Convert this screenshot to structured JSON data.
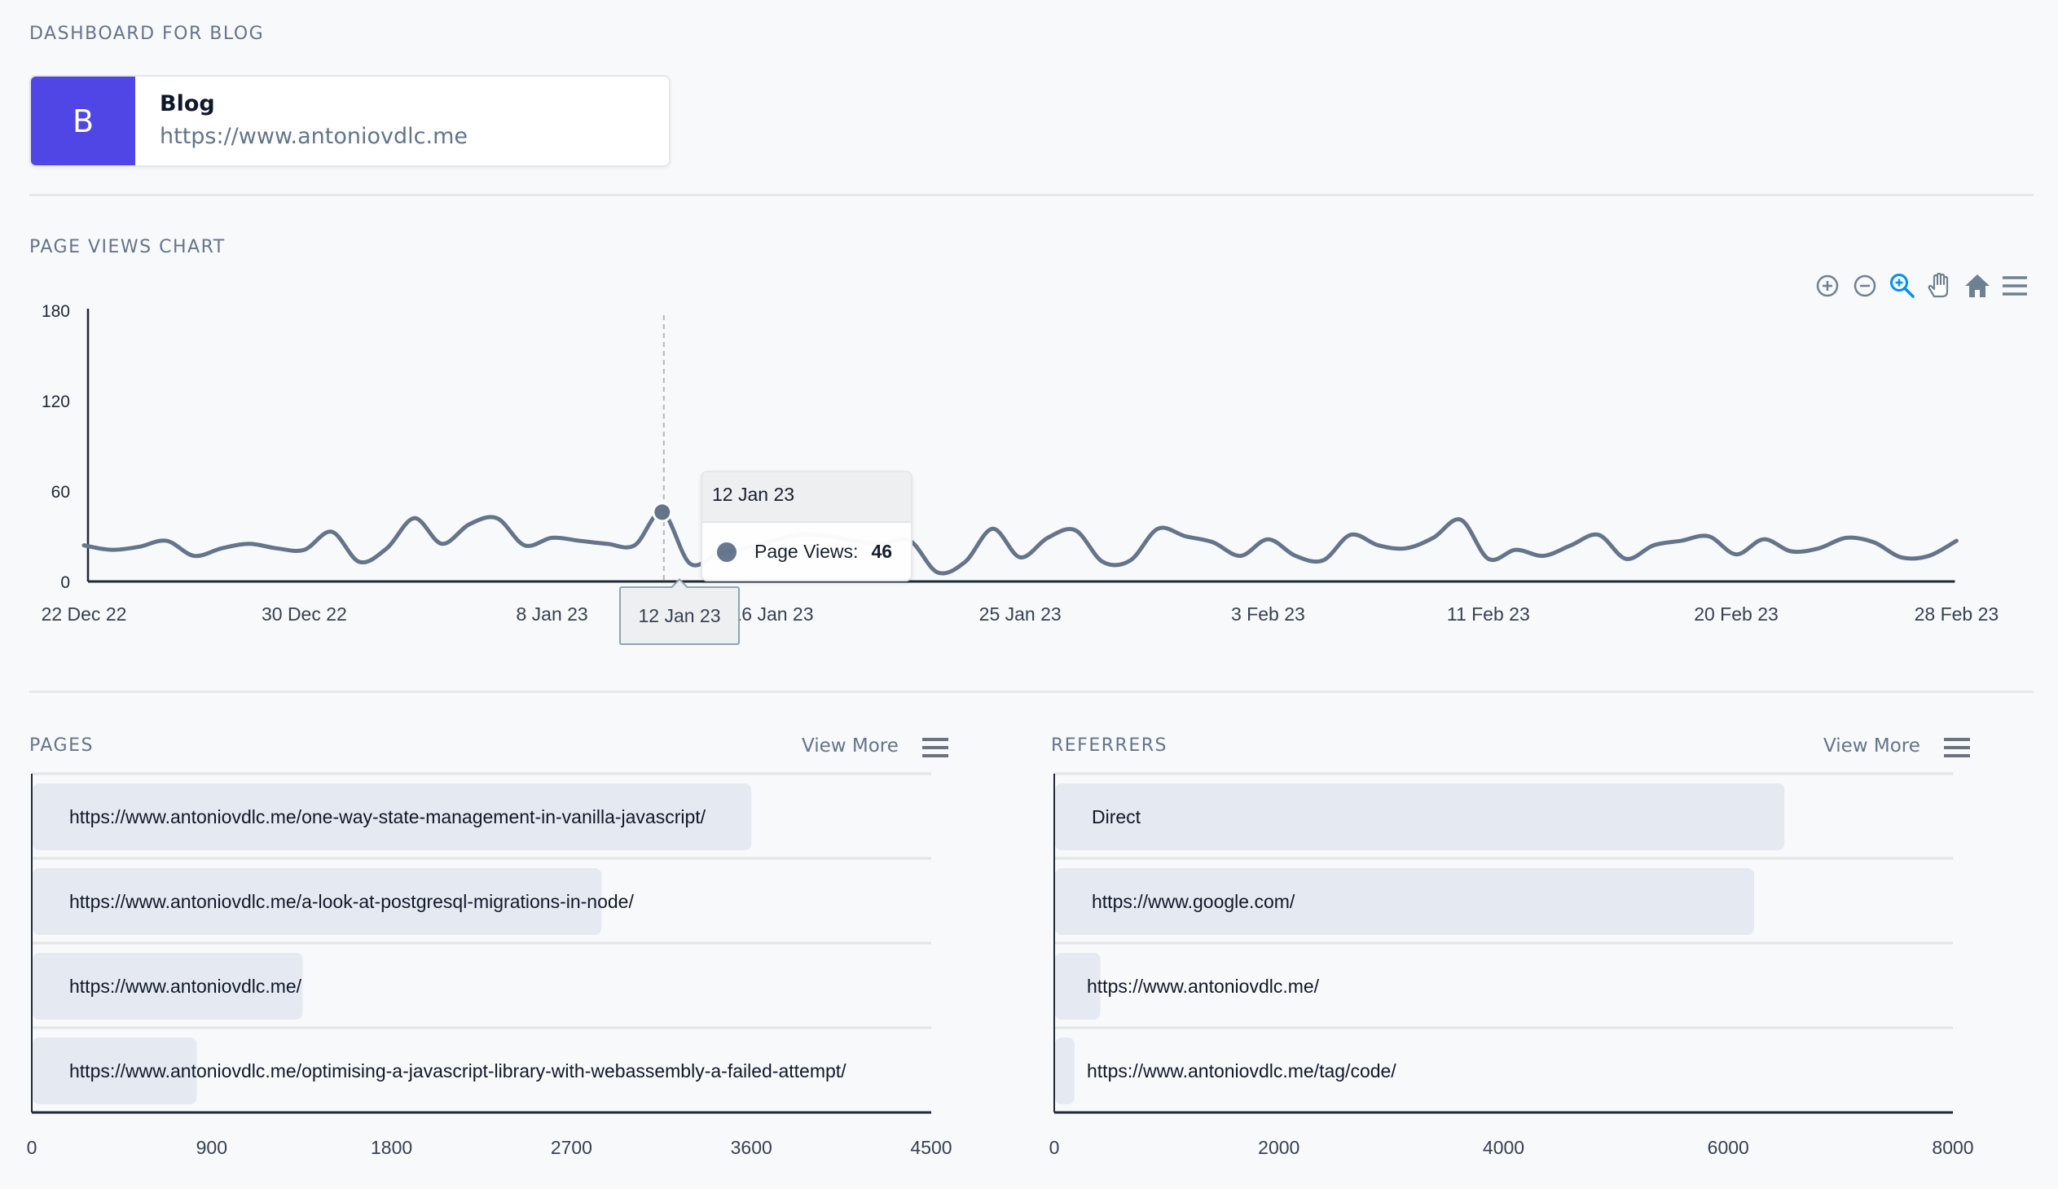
{
  "header": {
    "title": "DASHBOARD FOR BLOG"
  },
  "site": {
    "initial": "B",
    "name": "Blog",
    "url": "https://www.antoniovdlc.me",
    "avatar_color": "#4f46e5"
  },
  "page_views": {
    "title": "PAGE VIEWS CHART",
    "toolbar": [
      {
        "icon": "zoom-in-icon",
        "label": "Zoom In"
      },
      {
        "icon": "zoom-out-icon",
        "label": "Zoom Out"
      },
      {
        "icon": "selection-zoom-icon",
        "label": "Selection Zoom",
        "active": true
      },
      {
        "icon": "pan-hand-icon",
        "label": "Panning"
      },
      {
        "icon": "home-reset-icon",
        "label": "Reset Zoom"
      },
      {
        "icon": "menu-icon",
        "label": "Menu"
      }
    ],
    "tooltip": {
      "date": "12 Jan 23",
      "series_label": "Page Views:",
      "value": "46"
    },
    "crosshair_label": "12 Jan 23"
  },
  "pages": {
    "title": "PAGES",
    "view_more": "View More"
  },
  "referrers": {
    "title": "REFERRERS",
    "view_more": "View More"
  },
  "chart_data": [
    {
      "type": "line",
      "title": "PAGE VIEWS CHART",
      "series": [
        {
          "name": "Page Views",
          "color": "#64748b",
          "start_date": "2022-12-22",
          "values": [
            24,
            21,
            23,
            27,
            17,
            22,
            25,
            22,
            21,
            33,
            13,
            22,
            42,
            25,
            38,
            42,
            24,
            29,
            27,
            25,
            24,
            46,
            12,
            18,
            22,
            27,
            31,
            30,
            27,
            25,
            27,
            6,
            13,
            35,
            16,
            29,
            34,
            13,
            14,
            35,
            30,
            26,
            17,
            28,
            17,
            14,
            31,
            24,
            22,
            29,
            41,
            15,
            21,
            17,
            24,
            31,
            15,
            24,
            27,
            30,
            18,
            28,
            20,
            22,
            29,
            26,
            16,
            17,
            27
          ]
        }
      ],
      "x_tick_labels": [
        "22 Dec 22",
        "30 Dec 22",
        "8 Jan 23",
        "12 Jan 23",
        "16 Jan 23",
        "25 Jan 23",
        "3 Feb 23",
        "11 Feb 23",
        "20 Feb 23",
        "28 Feb 23"
      ],
      "x_tick_days": [
        0,
        8,
        17,
        21,
        25,
        34,
        43,
        51,
        60,
        68
      ],
      "y_tick_labels": [
        "0",
        "60",
        "120",
        "180"
      ],
      "ylim": [
        0,
        180
      ],
      "highlighted_point": {
        "day": 21,
        "label": "12 Jan 23",
        "value": 46
      },
      "grid": false
    },
    {
      "type": "bar",
      "orientation": "horizontal",
      "title": "PAGES",
      "categories": [
        "https://www.antoniovdlc.me/one-way-state-management-in-vanilla-javascript/",
        "https://www.antoniovdlc.me/a-look-at-postgresql-migrations-in-node/",
        "https://www.antoniovdlc.me/",
        "https://www.antoniovdlc.me/optimising-a-javascript-library-with-webassembly-a-failed-attempt/"
      ],
      "values": [
        3600,
        2850,
        1355,
        825
      ],
      "x_tick_labels": [
        "0",
        "900",
        "1800",
        "2700",
        "3600",
        "4500"
      ],
      "xlim": [
        0,
        4500
      ],
      "bar_color": "#e5e9f2"
    },
    {
      "type": "bar",
      "orientation": "horizontal",
      "title": "REFERRERS",
      "categories": [
        "Direct",
        "https://www.google.com/",
        "https://www.antoniovdlc.me/",
        "https://www.antoniovdlc.me/tag/code/"
      ],
      "values": [
        6500,
        6230,
        410,
        180
      ],
      "x_tick_labels": [
        "0",
        "2000",
        "4000",
        "6000",
        "8000"
      ],
      "xlim": [
        0,
        8000
      ],
      "bar_color": "#e5e9f2"
    }
  ]
}
